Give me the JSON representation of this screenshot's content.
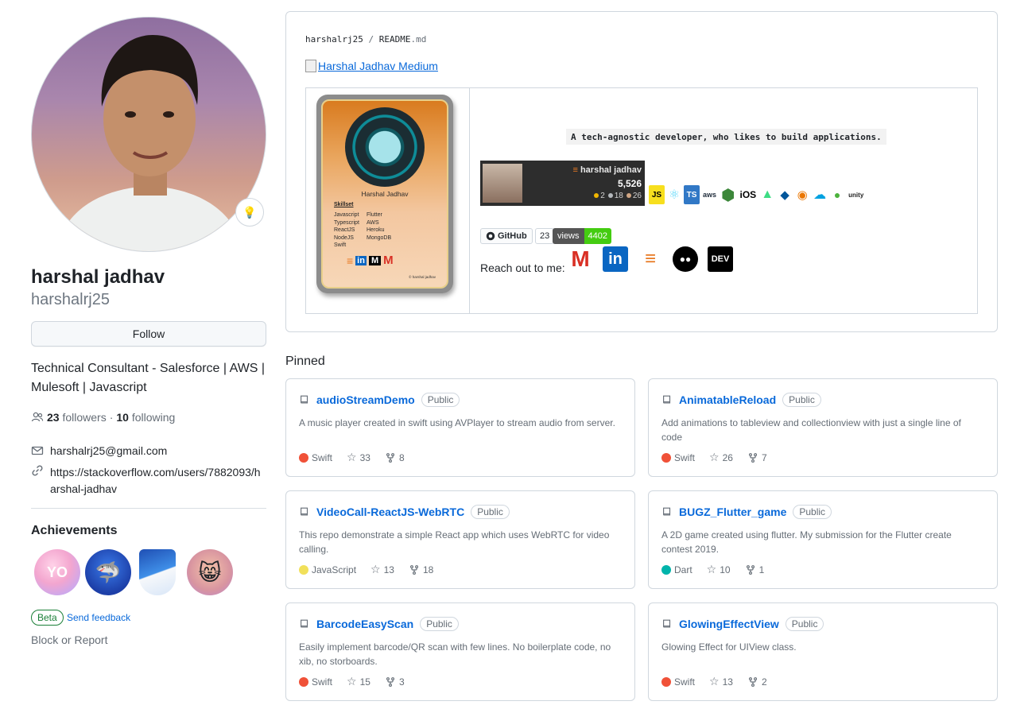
{
  "profile": {
    "fullname": "harshal jadhav",
    "login": "harshalrj25",
    "follow_label": "Follow",
    "bio": "Technical Consultant - Salesforce | AWS | Mulesoft | Javascript",
    "followers_count": "23",
    "followers_label": "followers",
    "separator": "·",
    "following_count": "10",
    "following_label": "following",
    "email": "harshalrj25@gmail.com",
    "website": "https://stackoverflow.com/users/7882093/harshal-jadhav",
    "achievements_title": "Achievements",
    "beta_label": "Beta",
    "send_feedback": "Send feedback",
    "block_report": "Block or Report"
  },
  "readme": {
    "owner": "harshalrj25",
    "slash": "/",
    "file": "README",
    "ext": ".md",
    "medium_link": "Harshal Jadhav Medium",
    "card": {
      "name": "Harshal Jadhav",
      "skills_title": "Skillset",
      "skills": [
        "Javascript",
        "Flutter",
        "Typescript",
        "AWS",
        "ReactJS",
        "Heroku",
        "NodeJS",
        "MongoDB",
        "Swift",
        ""
      ],
      "copyright": "© harshal jadhav"
    },
    "tagline": "A tech-agnostic developer, who likes to build applications.",
    "so_flair": {
      "name": "harshal jadhav",
      "reputation": "5,526",
      "gold": "2",
      "silver": "18",
      "bronze": "26"
    },
    "tech": [
      "JS",
      "⚛",
      "TS",
      "aws",
      "⬢",
      "iOS",
      "▲",
      "◆",
      "◉",
      "☁",
      "●",
      "unity"
    ],
    "github_badge": "GitHub",
    "github_count": "23",
    "views_label": "views",
    "views_count": "4402",
    "reach_label": "Reach out to me:",
    "reach_icons": [
      "M",
      "in",
      "≡",
      "●●",
      "DEV"
    ]
  },
  "pinned": {
    "title": "Pinned",
    "repos": [
      {
        "name": "audioStreamDemo",
        "visibility": "Public",
        "desc": "A music player created in swift using AVPlayer to stream audio from server.",
        "lang": "Swift",
        "lang_color": "#F05138",
        "stars": "33",
        "forks": "8"
      },
      {
        "name": "AnimatableReload",
        "visibility": "Public",
        "desc": "Add animations to tableview and collectionview with just a single line of code",
        "lang": "Swift",
        "lang_color": "#F05138",
        "stars": "26",
        "forks": "7"
      },
      {
        "name": "VideoCall-ReactJS-WebRTC",
        "visibility": "Public",
        "desc": "This repo demonstrate a simple React app which uses WebRTC for video calling.",
        "lang": "JavaScript",
        "lang_color": "#f1e05a",
        "stars": "13",
        "forks": "18"
      },
      {
        "name": "BUGZ_Flutter_game",
        "visibility": "Public",
        "desc": "A 2D game created using flutter. My submission for the Flutter create contest 2019.",
        "lang": "Dart",
        "lang_color": "#00B4AB",
        "stars": "10",
        "forks": "1"
      },
      {
        "name": "BarcodeEasyScan",
        "visibility": "Public",
        "desc": "Easily implement barcode/QR scan with few lines. No boilerplate code, no xib, no storboards.",
        "lang": "Swift",
        "lang_color": "#F05138",
        "stars": "15",
        "forks": "3"
      },
      {
        "name": "GlowingEffectView",
        "visibility": "Public",
        "desc": "Glowing Effect for UIView class.",
        "lang": "Swift",
        "lang_color": "#F05138",
        "stars": "13",
        "forks": "2"
      }
    ]
  }
}
